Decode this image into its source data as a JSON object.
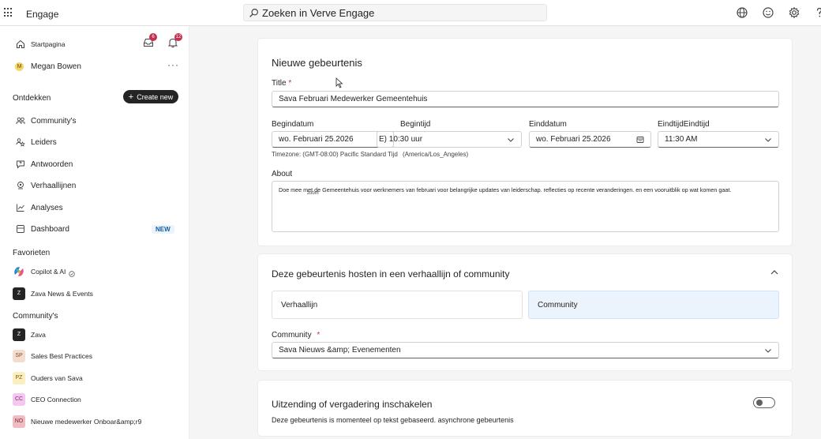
{
  "app": {
    "name": "Engage"
  },
  "search": {
    "placeholder": "Zoeken in Verve Engage"
  },
  "sidebar": {
    "home_label": "Startpagina",
    "notif_badge_1": "6",
    "notif_badge_2": "12",
    "user": {
      "initial": "M",
      "name": "Megan Bowen"
    },
    "discover_label": "Ontdekken",
    "create_label": "Create new",
    "nav": [
      {
        "label": "Community's",
        "icon": "communities-icon"
      },
      {
        "label": "Leiders",
        "icon": "leaders-icon"
      },
      {
        "label": "Antwoorden",
        "icon": "answers-icon"
      },
      {
        "label": "Verhaallijnen",
        "icon": "storylines-icon"
      },
      {
        "label": "Analyses",
        "icon": "analytics-icon"
      },
      {
        "label": "Dashboard",
        "icon": "dashboard-icon",
        "badge": "NEW"
      }
    ],
    "favorites_label": "Favorieten",
    "favorites": [
      {
        "label": "Copilot & AI",
        "icon": "copilot-icon"
      },
      {
        "label": "Zava News & Events",
        "initials": "Z"
      }
    ],
    "communities_label": "Community's",
    "communities": [
      {
        "initials": "Z",
        "label": "Zava",
        "bg": "#242424",
        "fg": "#ffffff"
      },
      {
        "initials": "SP",
        "label": "Sales Best Practices",
        "bg": "#f3ddd0",
        "fg": "#8a4a26"
      },
      {
        "initials": "PZ",
        "label": "Ouders van Sava",
        "bg": "#fbeec0",
        "fg": "#7a5a00"
      },
      {
        "initials": "CC",
        "label": "CEO Connection",
        "bg": "#f3c7ee",
        "fg": "#7a2a6b"
      },
      {
        "initials": "NO",
        "label": "Nieuwe medewerker Onboar&amp;r9",
        "bg": "#eebdc3",
        "fg": "#7a2a33"
      }
    ]
  },
  "event_form": {
    "heading": "Nieuwe gebeurtenis",
    "title_label": "Title",
    "required_mark": "*",
    "title_value": "Sava Februari Medewerker Gemeentehuis",
    "start_date_label": "Begindatum",
    "start_date_value": "wo. Februari 25.2026",
    "start_time_label": "Begintijd",
    "start_time_value": "E) 10:30 uur",
    "end_date_label": "Einddatum",
    "end_date_value": "wo. Februari 25.2026",
    "end_time_label": "EindtijdEindtijd",
    "end_time_value": "11:30 AM",
    "timezone_note": "Timezone: (GMT-08:00) Pacific Standard Tijd",
    "timezone_id": "(America/Los_Angeles)",
    "about_label": "About",
    "about_value": "Doe mee met de Gemeentehuis voor werknemers van februari voor belangrijke updates van leiderschap. reflecties op recente veranderingen. en een vooruitblik op wat komen gaat.",
    "about_overlap": "zoom"
  },
  "host_section": {
    "heading": "Deze gebeurtenis hosten in een verhaallijn of community",
    "option_storyline": "Verhaallijn",
    "option_community": "Community",
    "community_label": "Community",
    "community_value": "Sava Nieuws &amp; Evenementen"
  },
  "broadcast_section": {
    "heading": "Uitzending of vergadering inschakelen",
    "description": "Deze gebeurtenis is momenteel op tekst gebaseerd. asynchrone gebeurtenis",
    "enabled": false
  },
  "colors": {
    "accent": "#115ea3",
    "badge_red": "#c4314b",
    "selected_bg": "#ebf3fc"
  }
}
